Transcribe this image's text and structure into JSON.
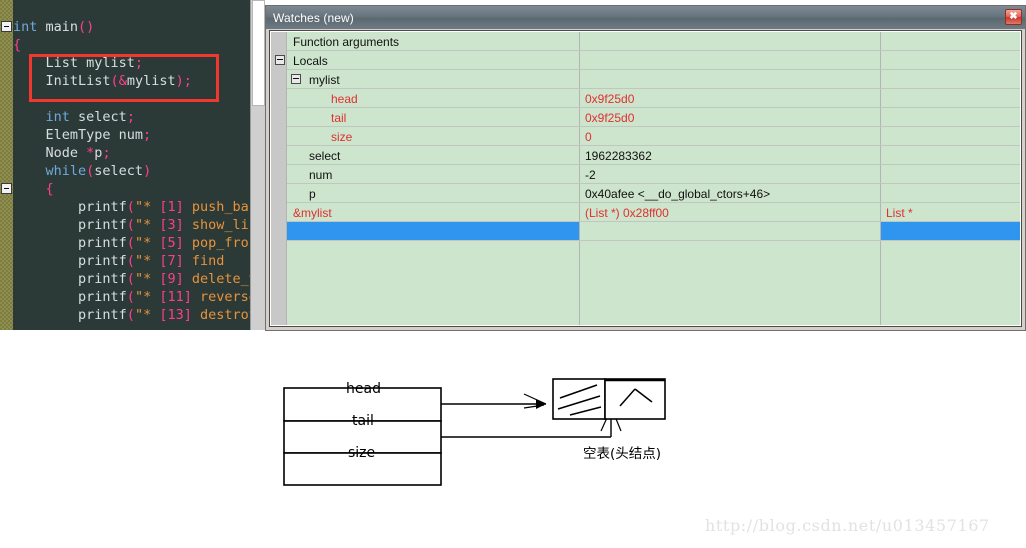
{
  "editor": {
    "lines": [
      [
        {
          "t": "",
          "c": "pl"
        }
      ],
      [
        {
          "t": "int",
          "c": "kw"
        },
        {
          "t": " main",
          "c": "pl"
        },
        {
          "t": "()",
          "c": "pn"
        }
      ],
      [
        {
          "t": "{",
          "c": "pn"
        }
      ],
      [
        {
          "t": "    List mylist",
          "c": "pl"
        },
        {
          "t": ";",
          "c": "pn"
        }
      ],
      [
        {
          "t": "    InitList",
          "c": "pl"
        },
        {
          "t": "(",
          "c": "pn"
        },
        {
          "t": "&",
          "c": "pn"
        },
        {
          "t": "mylist",
          "c": "pl"
        },
        {
          "t": ");",
          "c": "pn"
        }
      ],
      [
        {
          "t": "",
          "c": "pl"
        }
      ],
      [
        {
          "t": "    ",
          "c": "pl"
        },
        {
          "t": "int",
          "c": "kw"
        },
        {
          "t": " select",
          "c": "pl"
        },
        {
          "t": ";",
          "c": "pn"
        }
      ],
      [
        {
          "t": "    ElemType num",
          "c": "pl"
        },
        {
          "t": ";",
          "c": "pn"
        }
      ],
      [
        {
          "t": "    Node ",
          "c": "pl"
        },
        {
          "t": "*",
          "c": "pn"
        },
        {
          "t": "p",
          "c": "pl"
        },
        {
          "t": ";",
          "c": "pn"
        }
      ],
      [
        {
          "t": "    ",
          "c": "pl"
        },
        {
          "t": "while",
          "c": "kw"
        },
        {
          "t": "(",
          "c": "pn"
        },
        {
          "t": "select",
          "c": "pl"
        },
        {
          "t": ")",
          "c": "pn"
        }
      ],
      [
        {
          "t": "    ",
          "c": "pl"
        },
        {
          "t": "{",
          "c": "pn"
        }
      ],
      [
        {
          "t": "        printf",
          "c": "pl"
        },
        {
          "t": "(",
          "c": "pn"
        },
        {
          "t": "\"* ",
          "c": "str"
        },
        {
          "t": "[1]",
          "c": "pn"
        },
        {
          "t": " push_back",
          "c": "str"
        }
      ],
      [
        {
          "t": "        printf",
          "c": "pl"
        },
        {
          "t": "(",
          "c": "pn"
        },
        {
          "t": "\"* ",
          "c": "str"
        },
        {
          "t": "[3]",
          "c": "pn"
        },
        {
          "t": " show_list",
          "c": "str"
        }
      ],
      [
        {
          "t": "        printf",
          "c": "pl"
        },
        {
          "t": "(",
          "c": "pn"
        },
        {
          "t": "\"* ",
          "c": "str"
        },
        {
          "t": "[5]",
          "c": "pn"
        },
        {
          "t": " pop_front",
          "c": "str"
        }
      ],
      [
        {
          "t": "        printf",
          "c": "pl"
        },
        {
          "t": "(",
          "c": "pn"
        },
        {
          "t": "\"* ",
          "c": "str"
        },
        {
          "t": "[7]",
          "c": "pn"
        },
        {
          "t": " find",
          "c": "str"
        }
      ],
      [
        {
          "t": "        printf",
          "c": "pl"
        },
        {
          "t": "(",
          "c": "pn"
        },
        {
          "t": "\"* ",
          "c": "str"
        },
        {
          "t": "[9]",
          "c": "pn"
        },
        {
          "t": " delete_val",
          "c": "str"
        }
      ],
      [
        {
          "t": "        printf",
          "c": "pl"
        },
        {
          "t": "(",
          "c": "pn"
        },
        {
          "t": "\"* ",
          "c": "str"
        },
        {
          "t": "[11]",
          "c": "pn"
        },
        {
          "t": " reverse",
          "c": "str"
        }
      ],
      [
        {
          "t": "        printf",
          "c": "pl"
        },
        {
          "t": "(",
          "c": "pn"
        },
        {
          "t": "\"* ",
          "c": "str"
        },
        {
          "t": "[13]",
          "c": "pn"
        },
        {
          "t": " destroy",
          "c": "str"
        }
      ]
    ],
    "highlight_note": "red-box around List mylist; / InitList(&mylist);"
  },
  "watches": {
    "title": "Watches (new)",
    "close_label": "✖",
    "columns": [
      "",
      "",
      ""
    ],
    "rows": [
      {
        "name": "Function arguments",
        "value": "",
        "type": "",
        "indent": 0,
        "toggle": false,
        "red": false
      },
      {
        "name": "Locals",
        "value": "",
        "type": "",
        "indent": 0,
        "toggle": true,
        "red": false
      },
      {
        "name": "mylist",
        "value": "",
        "type": "",
        "indent": 1,
        "toggle": true,
        "red": false
      },
      {
        "name": "head",
        "value": "0x9f25d0",
        "type": "",
        "indent": 2,
        "toggle": false,
        "red": true
      },
      {
        "name": "tail",
        "value": "0x9f25d0",
        "type": "",
        "indent": 2,
        "toggle": false,
        "red": true
      },
      {
        "name": "size",
        "value": "0",
        "type": "",
        "indent": 2,
        "toggle": false,
        "red": true
      },
      {
        "name": "select",
        "value": "1962283362",
        "type": "",
        "indent": 1,
        "toggle": false,
        "red": false
      },
      {
        "name": "num",
        "value": "-2",
        "type": "",
        "indent": 1,
        "toggle": false,
        "red": false
      },
      {
        "name": "p",
        "value": "0x40afee <__do_global_ctors+46>",
        "type": "",
        "indent": 1,
        "toggle": false,
        "red": false
      },
      {
        "name": "&mylist",
        "value": "(List *) 0x28ff00",
        "type": "List *",
        "indent": 0,
        "toggle": false,
        "red": true
      }
    ],
    "new_row": {
      "name": "",
      "value": "",
      "type": "",
      "ellipsis_label": "•••"
    },
    "colors": {
      "grid_bg": "#cde4cd",
      "selection": "#2f95ee",
      "red_text": "#e03030"
    }
  },
  "diagram": {
    "struct_fields": [
      "head",
      "tail",
      "size"
    ],
    "node_caption": "空表(头结点)",
    "node_left_cell": "garbage-data",
    "node_right_cell": "null-pointer"
  },
  "watermark": {
    "text": "http://blog.csdn.net/u013457167"
  }
}
